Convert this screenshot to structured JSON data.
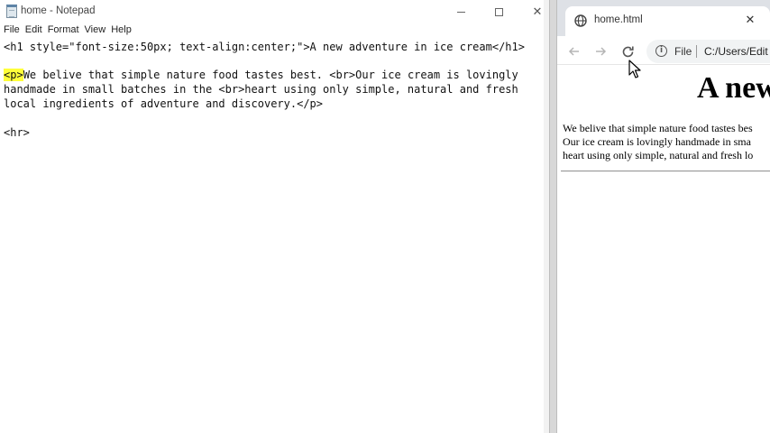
{
  "notepad": {
    "title": "home - Notepad",
    "controls": {
      "minimize": "",
      "maximize": "",
      "close": "✕"
    },
    "menu": [
      "File",
      "Edit",
      "Format",
      "View",
      "Help"
    ],
    "lines": [
      "<h1 style=\"font-size:50px; text-align:center;\">A new adventure in ice cream</h1>",
      "",
      "We belive that simple nature food tastes best. <br>Our ice cream is lovingly",
      "handmade in small batches in the <br>heart using only simple, natural and fresh",
      "local ingredients of adventure and discovery.</p>",
      "",
      "<hr>"
    ],
    "highlight": "<p>"
  },
  "browser": {
    "tab_title": "home.html",
    "tab_close": "✕",
    "omnibox": {
      "scheme": "File",
      "url": "C:/Users/Edit"
    },
    "page": {
      "heading": "A new",
      "paragraph_lines": [
        "We belive that simple nature food tastes bes",
        "Our ice cream is lovingly handmade in sma",
        "heart using only simple, natural and fresh lo"
      ]
    }
  },
  "icons": {
    "tab": "globe-icon",
    "back": "arrow-left-icon",
    "forward": "arrow-right-icon",
    "reload": "reload-icon",
    "site_info": "info-icon",
    "cursor": "mouse-pointer-icon"
  },
  "colors": {
    "highlight": "#ffff3a",
    "tab_strip": "#dee1e6",
    "omnibox": "#f1f3f4"
  }
}
